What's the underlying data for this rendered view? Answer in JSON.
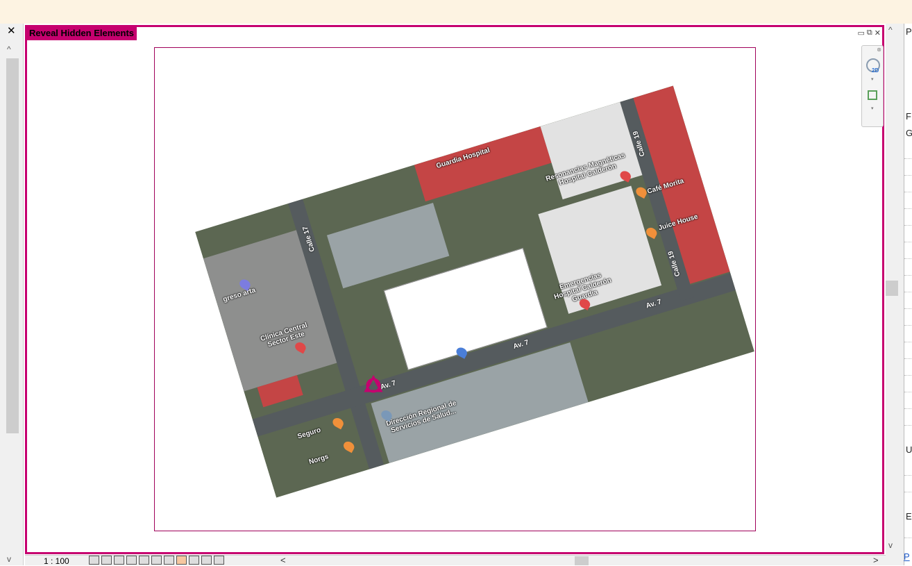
{
  "view": {
    "reveal_label": "Reveal Hidden Elements",
    "window_controls": {
      "minimize": "▭",
      "restore": "⧉",
      "close": "✕"
    }
  },
  "left_panel": {
    "close": "✕",
    "scroll_up": "^",
    "scroll_down": "v"
  },
  "nav_bar": {
    "wheel_badge": "2D",
    "close": "⊗",
    "expand_1": "▾",
    "expand_2": "▾"
  },
  "map": {
    "roads": [
      "Calle 17",
      "Calle 19",
      "Calle 19",
      "Av. 7",
      "Av. 7",
      "Av. 7"
    ],
    "places": [
      "Resonancias Magnéticas Hospital Calderón",
      "Café Morita",
      "Juice House",
      "Emergencias Hospital Calderón Guardia",
      "Clínica Central Sector Este",
      "Dirección Regional de Servicios de Salud...",
      "Guardia Hospital",
      "Norgs",
      "Seguro",
      "greso arta"
    ]
  },
  "status": {
    "scale": "1 : 100",
    "hscroll_left": "<",
    "hscroll_right": ">"
  },
  "right_panel": {
    "row_letters": [
      "P",
      "F",
      "G",
      "U",
      "E"
    ],
    "scroll_up": "^",
    "scroll_down": "v",
    "link": "P"
  },
  "colors": {
    "highlight": "#c6006f",
    "top_strip": "#fdf3e2"
  }
}
